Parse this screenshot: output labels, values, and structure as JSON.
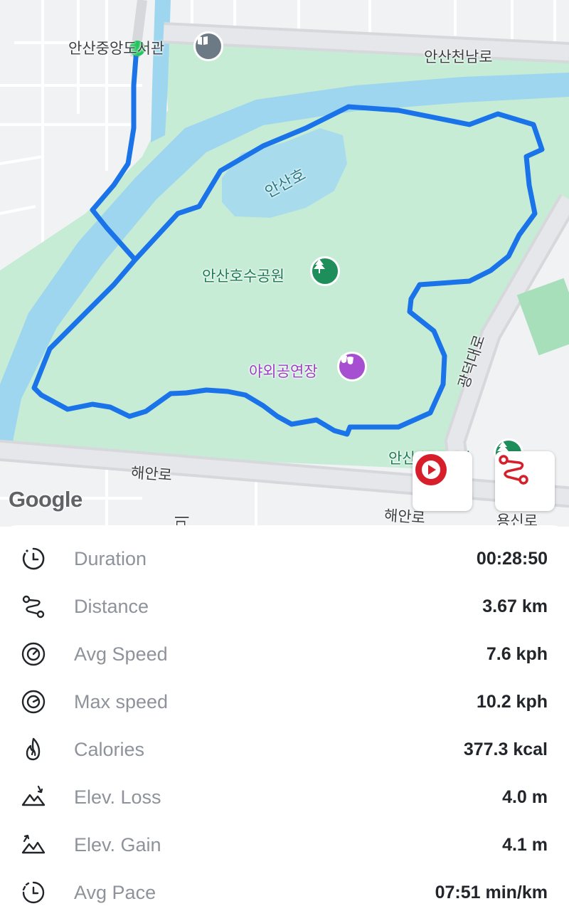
{
  "map": {
    "labels": {
      "library": "안산중앙도서관",
      "road_north": "안산천남로",
      "lake": "안산호",
      "park": "안산호수공원",
      "amphitheater": "야외공연장",
      "road_east": "광덕대로",
      "park_se": "안산호수공원",
      "road_south_w": "해안로",
      "road_south_e": "해안로",
      "road_se": "용신로",
      "road_bottom": "미"
    },
    "attribution": "Google",
    "route_color": "#1a73e8",
    "start_color": "#22c55e",
    "buttons": {
      "play": "play-button-icon",
      "route": "route-icon"
    }
  },
  "stats": [
    {
      "icon": "clock-icon",
      "label": "Duration",
      "value": "00:28:50"
    },
    {
      "icon": "route-icon",
      "label": "Distance",
      "value": "3.67 km"
    },
    {
      "icon": "speedometer-icon",
      "label": "Avg Speed",
      "value": "7.6 kph"
    },
    {
      "icon": "speedometer-icon",
      "label": "Max speed",
      "value": "10.2 kph"
    },
    {
      "icon": "flame-icon",
      "label": "Calories",
      "value": "377.3 kcal"
    },
    {
      "icon": "mountain-down-icon",
      "label": "Elev. Loss",
      "value": "4.0 m"
    },
    {
      "icon": "mountain-up-icon",
      "label": "Elev. Gain",
      "value": "4.1 m"
    },
    {
      "icon": "pace-clock-icon",
      "label": "Avg Pace",
      "value": "07:51 min/km"
    }
  ]
}
